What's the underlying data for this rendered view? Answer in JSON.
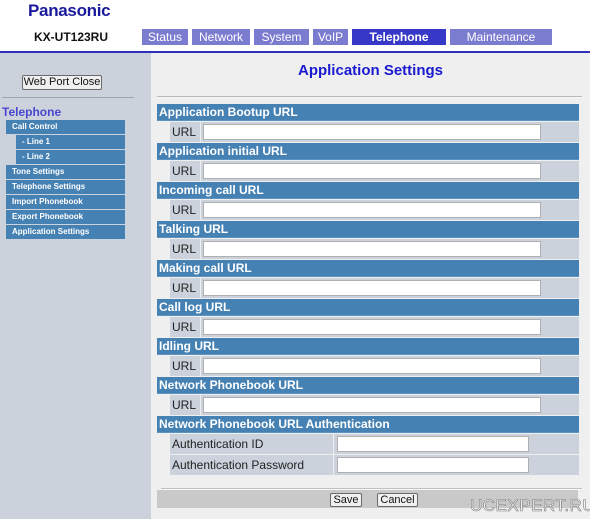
{
  "header": {
    "brand": "Panasonic",
    "model": "KX-UT123RU",
    "brand_color": "#1a1a9c",
    "tabs": [
      {
        "label": "Status",
        "active": false
      },
      {
        "label": "Network",
        "active": false
      },
      {
        "label": "System",
        "active": false
      },
      {
        "label": "VoIP",
        "active": false
      },
      {
        "label": "Telephone",
        "active": true
      },
      {
        "label": "Maintenance",
        "active": false
      }
    ]
  },
  "sidebar": {
    "web_port_close_label": "Web Port Close",
    "heading": "Telephone",
    "items": [
      {
        "label": "Call Control",
        "sub": false
      },
      {
        "label": "- Line 1",
        "sub": true
      },
      {
        "label": "- Line 2",
        "sub": true
      },
      {
        "label": "Tone Settings",
        "sub": false
      },
      {
        "label": "Telephone Settings",
        "sub": false
      },
      {
        "label": "Import Phonebook",
        "sub": false
      },
      {
        "label": "Export Phonebook",
        "sub": false
      },
      {
        "label": "Application Settings",
        "sub": false
      }
    ]
  },
  "main": {
    "title": "Application Settings",
    "sections": [
      {
        "title": "Application Bootup URL",
        "field_label": "URL",
        "value": ""
      },
      {
        "title": "Application initial URL",
        "field_label": "URL",
        "value": ""
      },
      {
        "title": "Incoming call URL",
        "field_label": "URL",
        "value": ""
      },
      {
        "title": "Talking URL",
        "field_label": "URL",
        "value": ""
      },
      {
        "title": "Making call URL",
        "field_label": "URL",
        "value": ""
      },
      {
        "title": "Call log URL",
        "field_label": "URL",
        "value": ""
      },
      {
        "title": "Idling URL",
        "field_label": "URL",
        "value": ""
      },
      {
        "title": "Network Phonebook URL",
        "field_label": "URL",
        "value": ""
      }
    ],
    "auth": {
      "title": "Network Phonebook URL Authentication",
      "id_label": "Authentication ID",
      "id_value": "",
      "password_label": "Authentication Password",
      "password_value": ""
    },
    "buttons": {
      "save": "Save",
      "cancel": "Cancel"
    }
  },
  "watermark": "UCEXPERT.RU",
  "colors": {
    "section_header": "#4681b4",
    "active_tab": "#3838c8",
    "inactive_tab": "#7b7bd0",
    "sidebar_bg": "#cbd2dc",
    "title": "#1a1ad0"
  }
}
